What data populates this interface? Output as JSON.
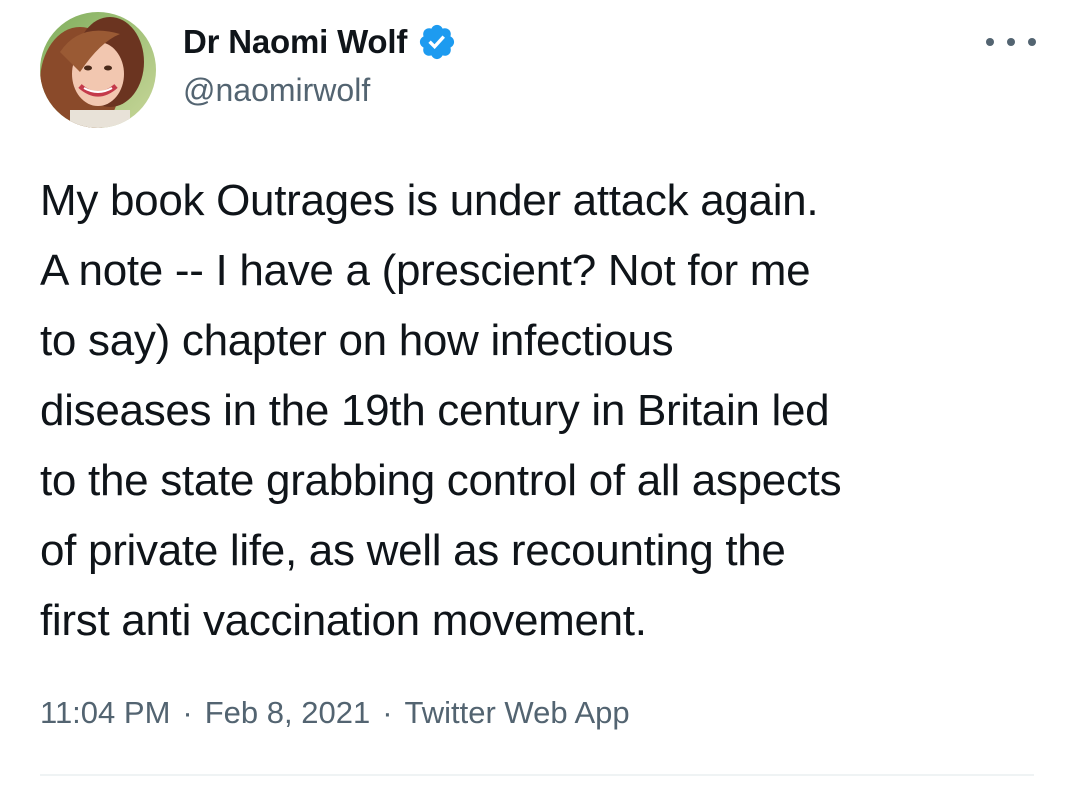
{
  "author": {
    "display_name": "Dr Naomi Wolf",
    "handle": "@naomirwolf",
    "verified": true,
    "avatar_icon": "profile-photo"
  },
  "tweet": {
    "text_lines": [
      "My book Outrages is under attack again.",
      "A note -- I have a (prescient? Not for me",
      "to say) chapter on how infectious",
      "diseases in the 19th century in Britain led",
      "to the state grabbing control of all aspects",
      "of private life, as well as recounting the",
      "first anti vaccination movement."
    ],
    "time": "11:04 PM",
    "date": "Feb 8, 2021",
    "source": "Twitter Web App",
    "separator": "·"
  },
  "icons": {
    "more": "more-options-icon",
    "verified": "verified-badge-icon"
  },
  "colors": {
    "text_primary": "#0f1419",
    "text_secondary": "#536471",
    "verified_blue": "#1d9bf0",
    "divider": "#eff3f4"
  }
}
